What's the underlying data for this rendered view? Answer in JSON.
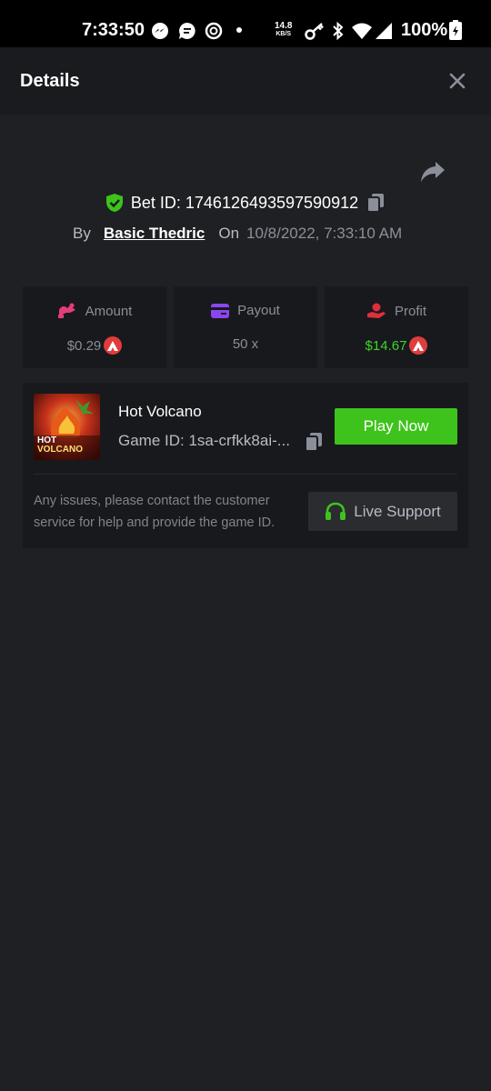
{
  "status_bar": {
    "time": "7:33:50",
    "net_speed_value": "14.8",
    "net_speed_unit": "KB/S",
    "battery": "100%"
  },
  "header": {
    "title": "Details"
  },
  "bet": {
    "label": "Bet ID: 1746126493597590912",
    "by_label": "By",
    "user": "Basic Thedric",
    "on_label": "On",
    "date": "10/8/2022, 7:33:10 AM"
  },
  "stats": {
    "amount": {
      "label": "Amount",
      "value": "$0.29"
    },
    "payout": {
      "label": "Payout",
      "value": "50 x"
    },
    "profit": {
      "label": "Profit",
      "value": "$14.67"
    }
  },
  "game": {
    "title": "Hot Volcano",
    "id_text": "Game ID: 1sa-crfkk8ai-...",
    "thumb_text_line1": "HOT",
    "thumb_text_line2": "VOLCANO",
    "play_label": "Play Now",
    "issues_text": "Any issues, please contact the customer service for help and provide the game ID.",
    "support_label": "Live Support"
  },
  "colors": {
    "background": "#1f2023",
    "card": "#18191c",
    "green": "#3ec21c",
    "profit_green": "#3ed42a",
    "amount_pink": "#e33e7a",
    "payout_purple": "#8a46f0",
    "profit_red": "#e02f3b",
    "coin_red": "#e03c3c",
    "shield_green": "#3ec21c"
  },
  "icons": [
    "messenger-icon",
    "chat-icon",
    "sync-icon",
    "key-icon",
    "bluetooth-icon",
    "wifi-icon",
    "signal-icon",
    "battery-icon",
    "close-icon",
    "share-icon",
    "shield-icon",
    "copy-icon",
    "amount-icon",
    "payout-icon",
    "profit-icon",
    "coin-icon",
    "headset-icon"
  ]
}
